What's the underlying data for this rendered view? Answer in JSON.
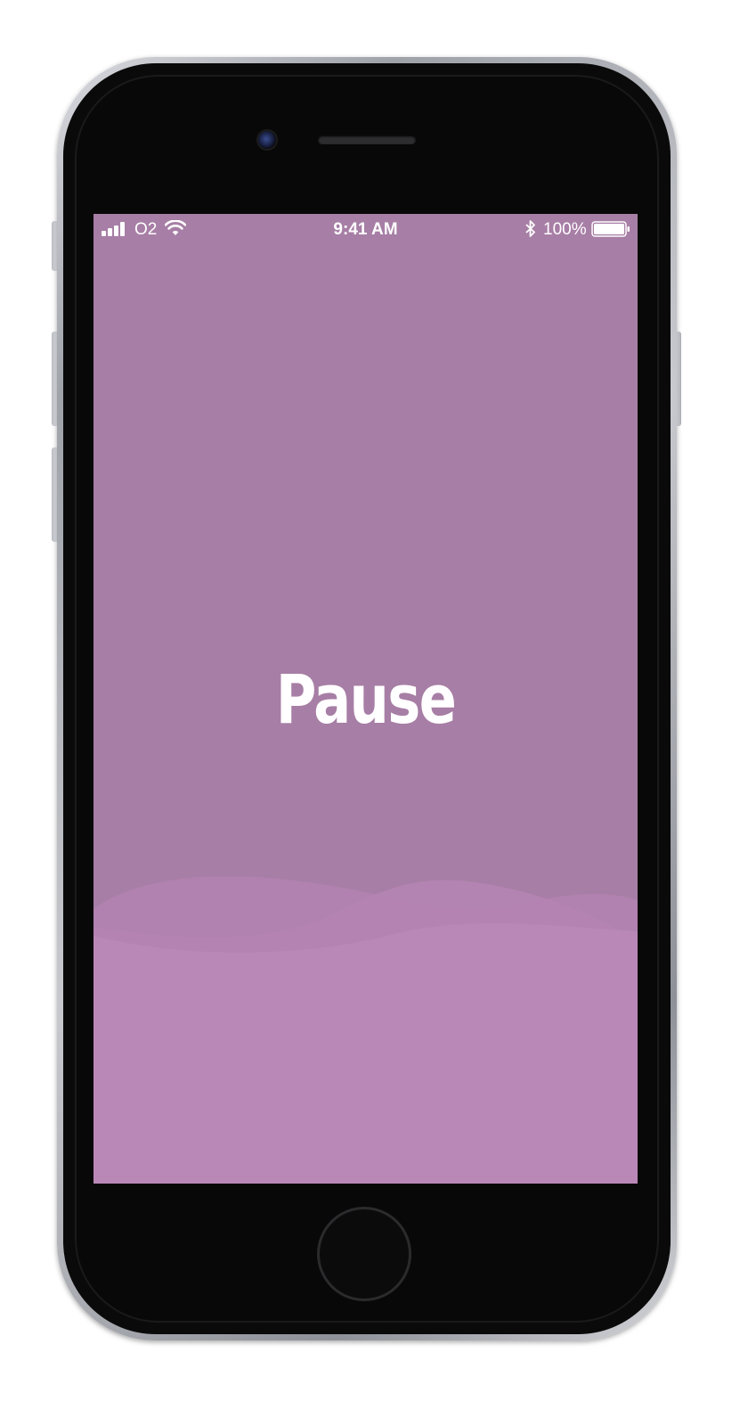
{
  "status_bar": {
    "carrier": "O2",
    "time": "9:41 AM",
    "battery_percent": "100%",
    "battery_level": 1.0,
    "signal_bars_filled": 4,
    "icons": [
      "signal-icon",
      "wifi-icon",
      "bluetooth-icon",
      "battery-icon"
    ]
  },
  "splash": {
    "logo_text": "Pause"
  },
  "colors": {
    "screen_background": "#a77ea5",
    "wave_fill": "#ba88b7",
    "text": "#ffffff",
    "device_bezel": "#0a0a0a"
  }
}
